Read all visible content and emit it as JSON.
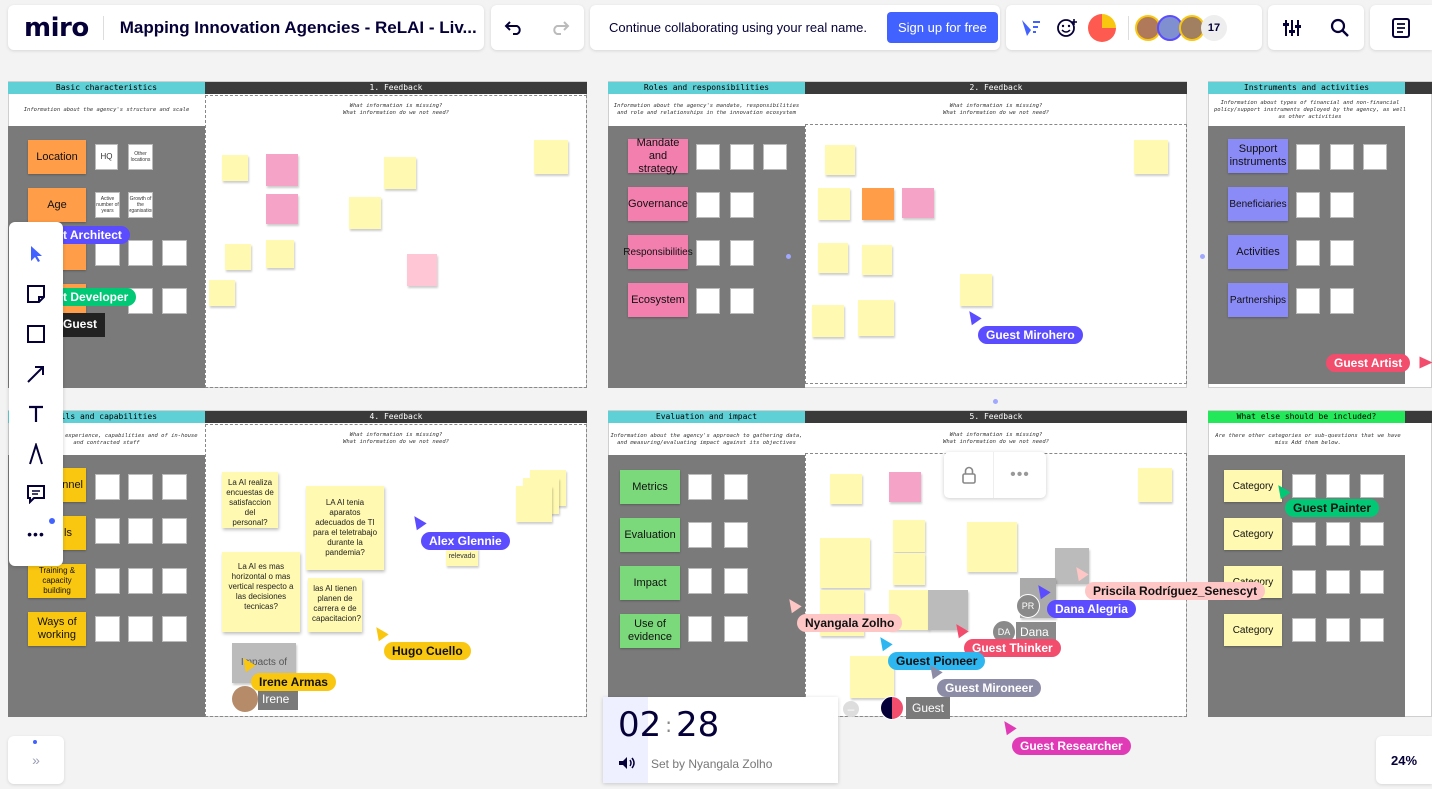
{
  "app": {
    "logo": "miro",
    "board_title": "Mapping Innovation Agencies - ReLAI - Liv..."
  },
  "topbar": {
    "collab_text": "Continue collaborating using your real name.",
    "signup_label": "Sign up for free",
    "participant_count": "17",
    "zoom": "24%"
  },
  "frames": {
    "basic": {
      "title": "Basic characteristics",
      "desc": "Information about the agency's structure and scale",
      "feedback": "1. Feedback"
    },
    "roles": {
      "title": "Roles and responsibilities",
      "desc": "Information about the agency's mandate, responsibilities and role and relationships in the innovation ecosystem",
      "feedback": "2. Feedback"
    },
    "instruments": {
      "title": "Instruments and activities",
      "desc": "Information about types of financial and non-financial policy/support instruments deployed by the agency, as well as other activities"
    },
    "skills": {
      "title": "ills and capabilities",
      "desc": "t backgrounds, experience, capabilities and of in-house and contracted staff",
      "feedback": "4. Feedback"
    },
    "evaluation": {
      "title": "Evaluation and impact",
      "desc": "Information about the agency's approach to gathering data, and measuring/evaluating impact against its objectives",
      "feedback": "5. Feedback"
    },
    "else": {
      "title": "What else should be included?",
      "desc": "Are there other categories or sub-questions that we have miss Add them below."
    }
  },
  "feedback_q": {
    "line1": "What information is missing?",
    "line2": "What information do we not need?"
  },
  "labels": {
    "basic": [
      "Location",
      "Age",
      "",
      "",
      ""
    ],
    "roles": [
      "Mandate and strategy",
      "Governance",
      "Responsibilities",
      "Ecosystem"
    ],
    "instruments": [
      "Support instruments",
      "Beneficiaries",
      "Activities",
      "Partnerships"
    ],
    "skills": [
      "nnel",
      "ls",
      "Training & capacity building",
      "Ways of working"
    ],
    "evaluation": [
      "Metrics",
      "Evaluation",
      "Impact",
      "Use of evidence"
    ],
    "else": [
      "Category",
      "Category",
      "Category",
      "Category"
    ]
  },
  "basic_minis": [
    "HQ",
    "Other locations",
    "Active number of years",
    "Growth of the organisation"
  ],
  "big_stickies": [
    "La AI realiza encuestas de satisfaccion del personal?",
    "LA AI tenia aparatos adecuados de TI para el teletrabajo durante la pandemia?",
    "La AI es mas horizontal o mas vertical respecto a las decisiones tecnicas?",
    "las AI tienen planen de carrera e de capacitacion?"
  ],
  "cursors": [
    {
      "name": "t Architect",
      "color": "#5b4cff"
    },
    {
      "name": "t Developer",
      "color": "#00c875"
    },
    {
      "name": "Guest",
      "color": "#222"
    },
    {
      "name": "Guest Mirohero",
      "color": "#5b4cff"
    },
    {
      "name": "Guest Artist",
      "color": "#f24d6d"
    },
    {
      "name": "Alex Glennie",
      "color": "#5b4cff"
    },
    {
      "name": "Hugo Cuello",
      "color": "#fac710"
    },
    {
      "name": "Irene Armas",
      "color": "#fac710"
    },
    {
      "name": "Guest Painter",
      "color": "#00c875"
    },
    {
      "name": "Priscila Rodríguez_Senescyt",
      "color": "#ffc6c6"
    },
    {
      "name": "Dana Alegria",
      "color": "#5b4cff"
    },
    {
      "name": "Nyangala Zolho",
      "color": "#ffc6c6"
    },
    {
      "name": "Guest Thinker",
      "color": "#f24d6d"
    },
    {
      "name": "Guest Pioneer",
      "color": "#2db6f0"
    },
    {
      "name": "Guest Mironeer",
      "color": "#8c8ca6"
    },
    {
      "name": "Guest Researcher",
      "color": "#e13ab7"
    }
  ],
  "small_labels": {
    "irene": "Irene",
    "dana": "Dana",
    "pr": "PR",
    "da": "DA",
    "guest_bottom": "Guest",
    "relevado": "relevado",
    "impacts": "Impacts of"
  },
  "timer": {
    "time_min": "02",
    "time_sec": "28",
    "set_by": "Set by Nyangala Zolho"
  }
}
